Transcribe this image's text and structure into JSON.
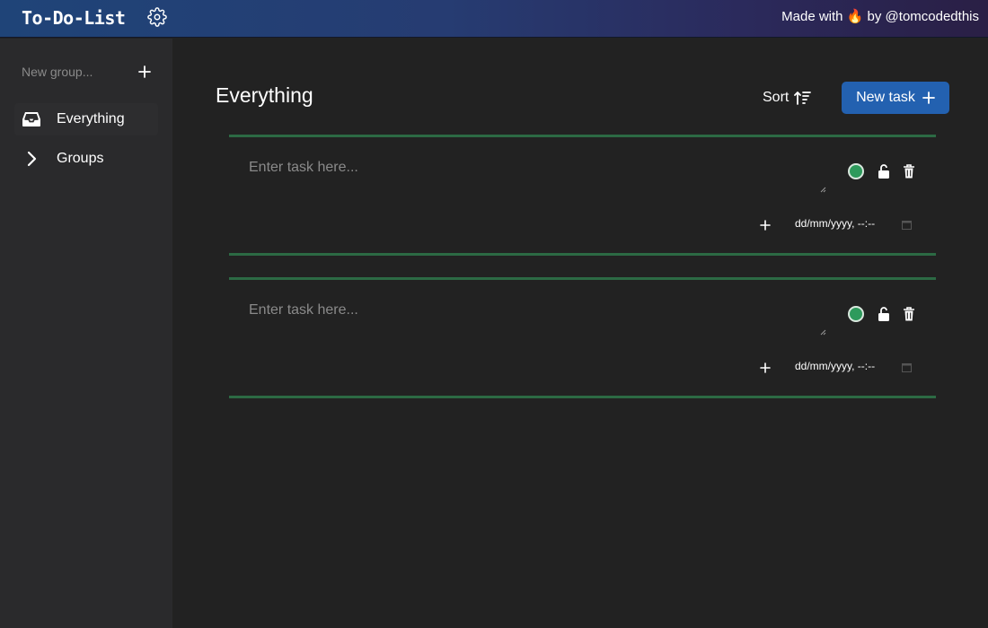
{
  "header": {
    "brand": "To-Do-List",
    "credit_prefix": "Made with ",
    "credit_emoji": "🔥",
    "credit_suffix": " by @tomcodedthis",
    "gradient_colors": [
      "#1f4478",
      "#2a1f45"
    ]
  },
  "sidebar": {
    "new_group_placeholder": "New group...",
    "items": [
      {
        "label": "Everything",
        "icon": "inbox-icon",
        "active": true
      },
      {
        "label": "Groups",
        "icon": "chevron-right-icon",
        "active": false
      }
    ]
  },
  "main": {
    "title": "Everything",
    "sort_label": "Sort",
    "new_task_label": "New task",
    "tasks": [
      {
        "placeholder": "Enter task here...",
        "date_placeholder": "dd/mm/yyyy, --:--",
        "status_color": "#2e9a5c"
      },
      {
        "placeholder": "Enter task here...",
        "date_placeholder": "dd/mm/yyyy, --:--",
        "status_color": "#2e9a5c"
      }
    ]
  },
  "colors": {
    "accent": "#2361b0",
    "task_border": "#2c6a44",
    "background": "#222222",
    "sidebar": "#2a2a2c"
  }
}
